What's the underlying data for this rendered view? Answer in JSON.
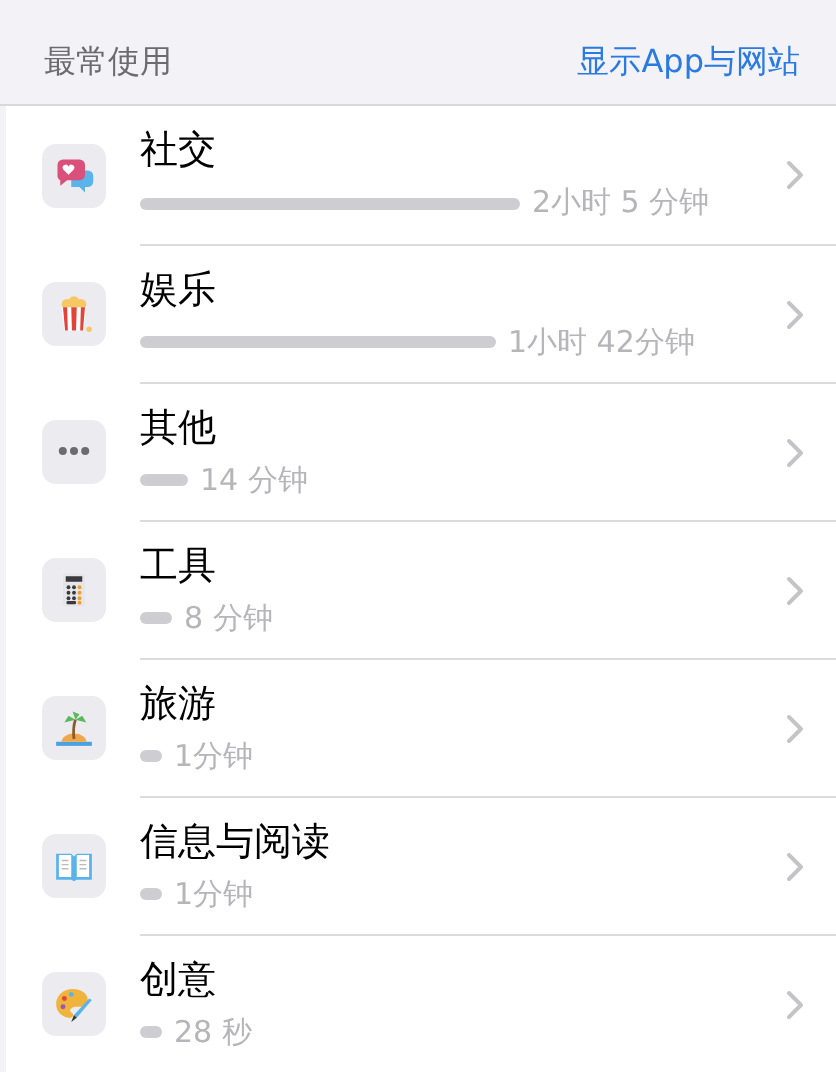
{
  "header": {
    "title": "最常使用",
    "link": "显示App与网站"
  },
  "categories": [
    {
      "name": "社交",
      "time": "2小时 5 分钟"
    },
    {
      "name": "娱乐",
      "time": "1小时 42分钟"
    },
    {
      "name": "其他",
      "time": "14 分钟"
    },
    {
      "name": "工具",
      "time": "8 分钟"
    },
    {
      "name": "旅游",
      "time": "1分钟"
    },
    {
      "name": "信息与阅读",
      "time": "1分钟"
    },
    {
      "name": "创意",
      "time": "28 秒"
    }
  ]
}
